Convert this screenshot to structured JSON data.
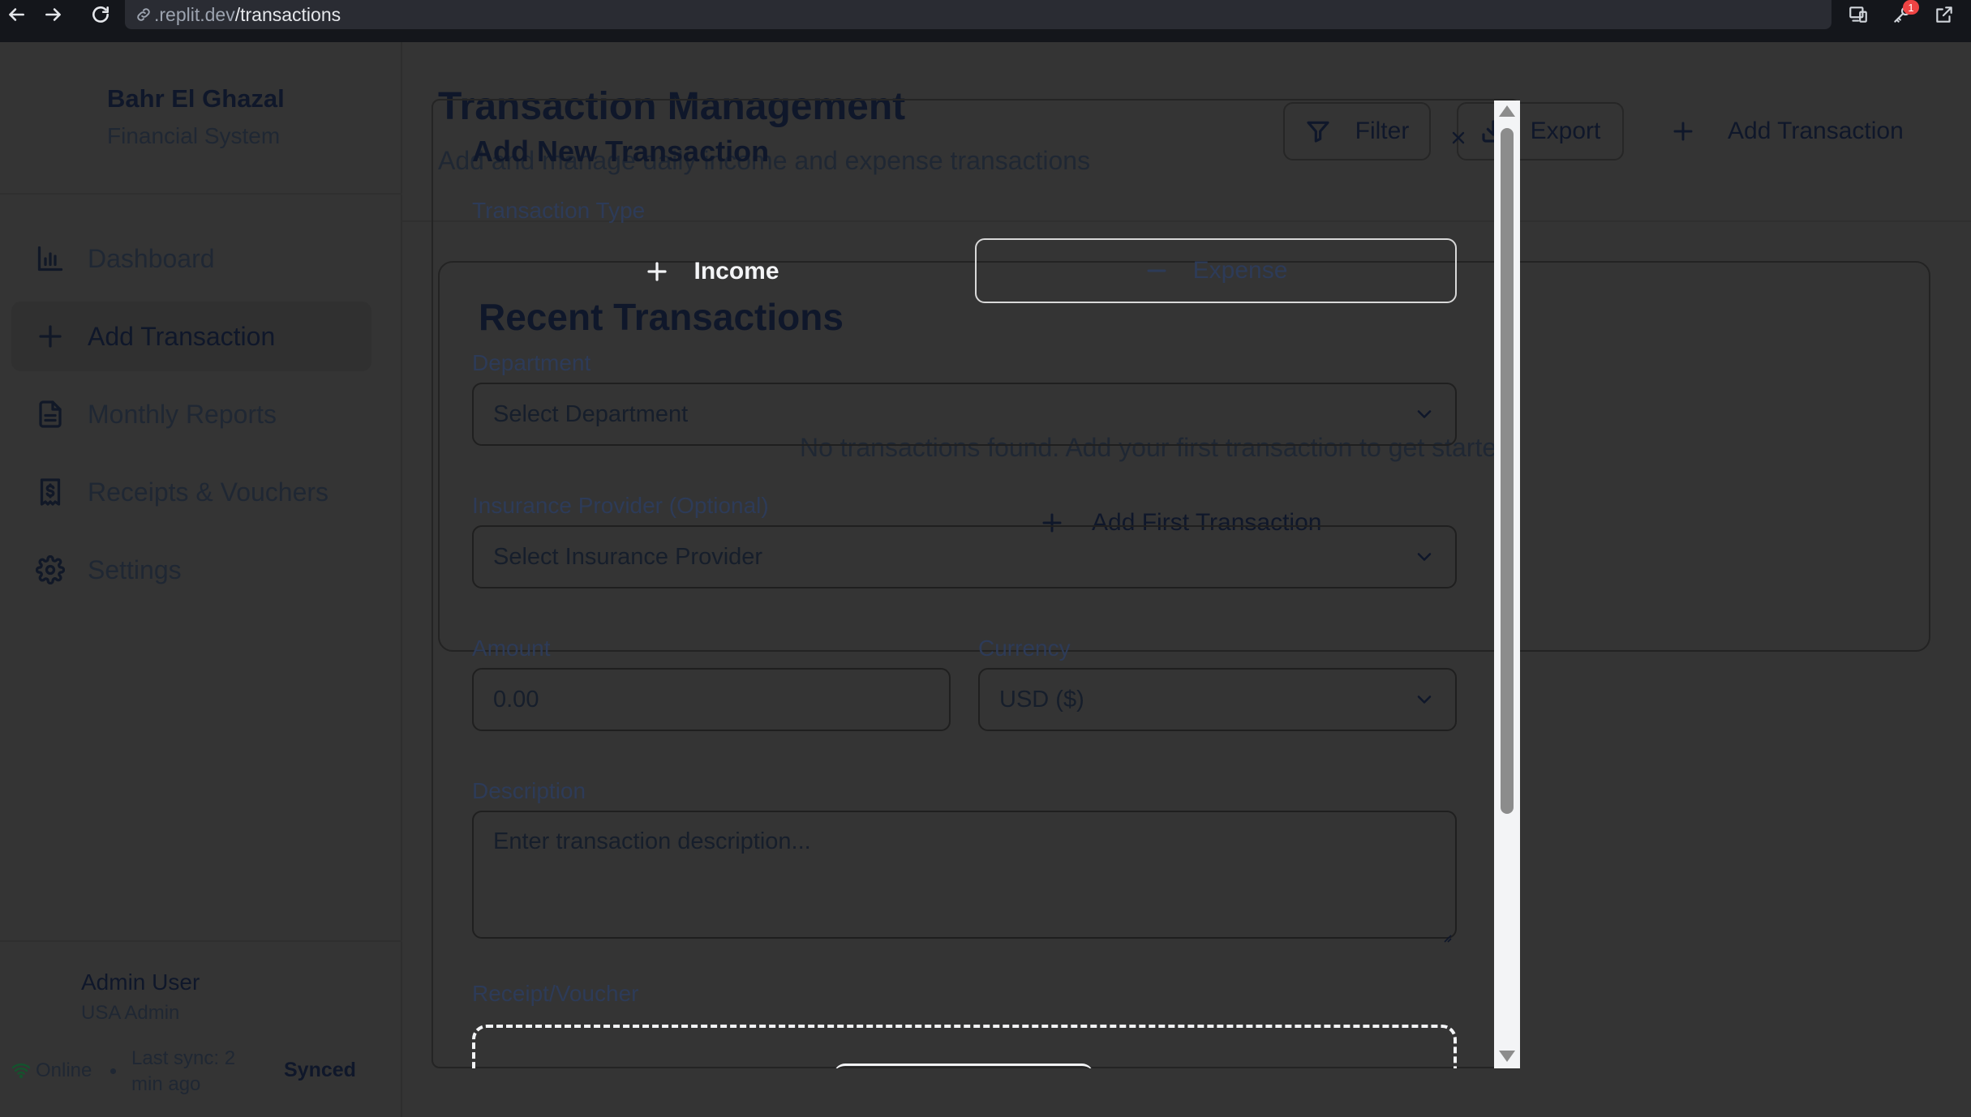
{
  "browser": {
    "url_prefix": ".replit.dev",
    "url_path": "/transactions",
    "notification_count": "1"
  },
  "sidebar": {
    "brand_title": "Bahr El Ghazal",
    "brand_subtitle": "Financial System",
    "items": [
      {
        "label": "Dashboard",
        "icon": "bar-chart-icon"
      },
      {
        "label": "Add Transaction",
        "icon": "plus-icon",
        "active": true
      },
      {
        "label": "Monthly Reports",
        "icon": "file-text-icon"
      },
      {
        "label": "Receipts & Vouchers",
        "icon": "receipt-dollar-icon"
      },
      {
        "label": "Settings",
        "icon": "gear-icon"
      }
    ],
    "user_name": "Admin User",
    "user_role": "USA Admin",
    "status_online": "Online",
    "last_sync": "Last sync: 2 min ago",
    "sync_status": "Synced"
  },
  "main": {
    "title": "Transaction Management",
    "subtitle": "Add and manage daily income and expense transactions",
    "filter_label": "Filter",
    "export_label": "Export",
    "add_transaction_label": "Add Transaction",
    "card_title": "Recent Transactions",
    "empty_message": "No transactions found. Add your first transaction to get started.",
    "add_first_label": "Add First Transaction"
  },
  "modal": {
    "title": "Add New Transaction",
    "transaction_type_label": "Transaction Type",
    "income_label": "Income",
    "expense_label": "Expense",
    "department_label": "Department",
    "department_placeholder": "Select Department",
    "insurance_label": "Insurance Provider (Optional)",
    "insurance_placeholder": "Select Insurance Provider",
    "amount_label": "Amount",
    "amount_placeholder": "0.00",
    "currency_label": "Currency",
    "currency_value": "USD ($)",
    "description_label": "Description",
    "description_placeholder": "Enter transaction description...",
    "receipt_label": "Receipt/Voucher"
  },
  "colors": {
    "background": "#343434",
    "browser_bar": "#14161b",
    "label_blue": "#2d3b58",
    "expense_border": "#d8d8d8",
    "badge": "#ef4444"
  }
}
